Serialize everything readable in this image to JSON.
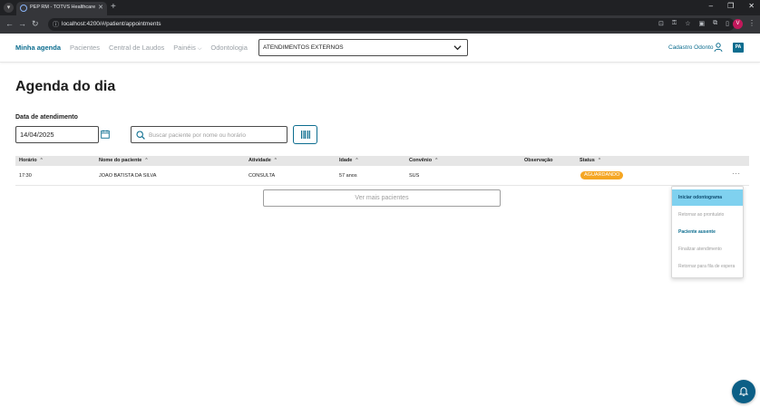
{
  "browser": {
    "tab_title": "PEP RM - TOTVS Healthcare",
    "url": "localhost:4200/#/patient/appointments",
    "profile_initial": "V"
  },
  "header": {
    "nav": [
      {
        "label": "Minha agenda",
        "active": true
      },
      {
        "label": "Pacientes",
        "active": false
      },
      {
        "label": "Central de Laudos",
        "active": false
      },
      {
        "label": "Painéis",
        "active": false,
        "has_dropdown": true
      },
      {
        "label": "Odontologia",
        "active": false
      }
    ],
    "department": "ATENDIMENTOS EXTERNOS",
    "user_name": "Cadastro Odonto",
    "brand_logo_text": "PA"
  },
  "main": {
    "title": "Agenda do dia",
    "date_label": "Data de atendimento",
    "date_value": "14/04/2025",
    "search_placeholder": "Buscar paciente por nome ou horário",
    "more_button": "Ver mais pacientes"
  },
  "table": {
    "columns": [
      "Horário",
      "Nome do paciente",
      "Atividade",
      "Idade",
      "Convênio",
      "Observação",
      "Status"
    ],
    "rows": [
      {
        "time": "17:30",
        "patient": "JOAO BATISTA DA SILVA",
        "activity": "CONSULTA",
        "age": "57 anos",
        "insurance": "SUS",
        "observation": "",
        "status": "AGUARDANDO"
      }
    ]
  },
  "row_menu": {
    "items": [
      {
        "label": "Iniciar odontograma",
        "state": "highlighted"
      },
      {
        "label": "Retornar ao prontuário",
        "state": "disabled"
      },
      {
        "label": "Paciente ausente",
        "state": "enabled"
      },
      {
        "label": "Finalizar atendimento",
        "state": "disabled"
      },
      {
        "label": "Retornar para fila de espera",
        "state": "disabled"
      }
    ]
  },
  "colors": {
    "primary": "#0c6d8f",
    "status_waiting": "#f5a623",
    "menu_highlight": "#7fd1ef"
  }
}
